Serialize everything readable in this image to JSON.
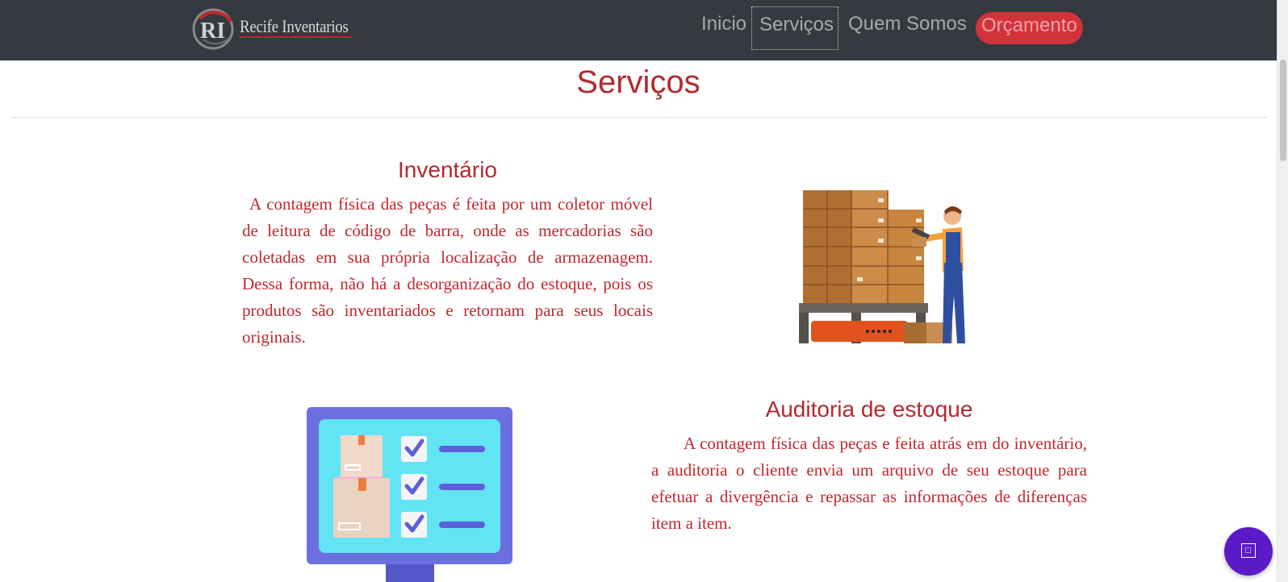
{
  "navbar": {
    "logo_text": "Recife Inventarios",
    "links": [
      "Inicio",
      "Serviços",
      "Quem Somos"
    ],
    "cta": "Orçamento"
  },
  "section_title": "Serviços",
  "services": [
    {
      "title": "Inventário",
      "text": "A contagem física das peças é feita por um coletor móvel de leitura de código de barra, onde as mercadorias são coletadas em sua própria localização de armazenagem. Dessa forma, não há a desorganização do estoque, pois os produtos são inventariados e retornam para seus locais originais.",
      "image_icon": "warehouse-worker-scanning-boxes-illustration"
    },
    {
      "title": "Auditoria de estoque",
      "text": "A contagem física das peças e feita atrás em do inventário, a auditoria o cliente envia um arquivo de seu estoque para efetuar a divergência e repassar as informações de diferenças item a item.",
      "image_icon": "inventory-checklist-monitor-illustration"
    }
  ],
  "colors": {
    "navbar_bg": "#343a40",
    "brand_red": "#c1272d",
    "cta_bg": "#d2333b",
    "widget_bg": "#5b1ac7"
  },
  "widget_icon": "accessibility-widget-icon"
}
